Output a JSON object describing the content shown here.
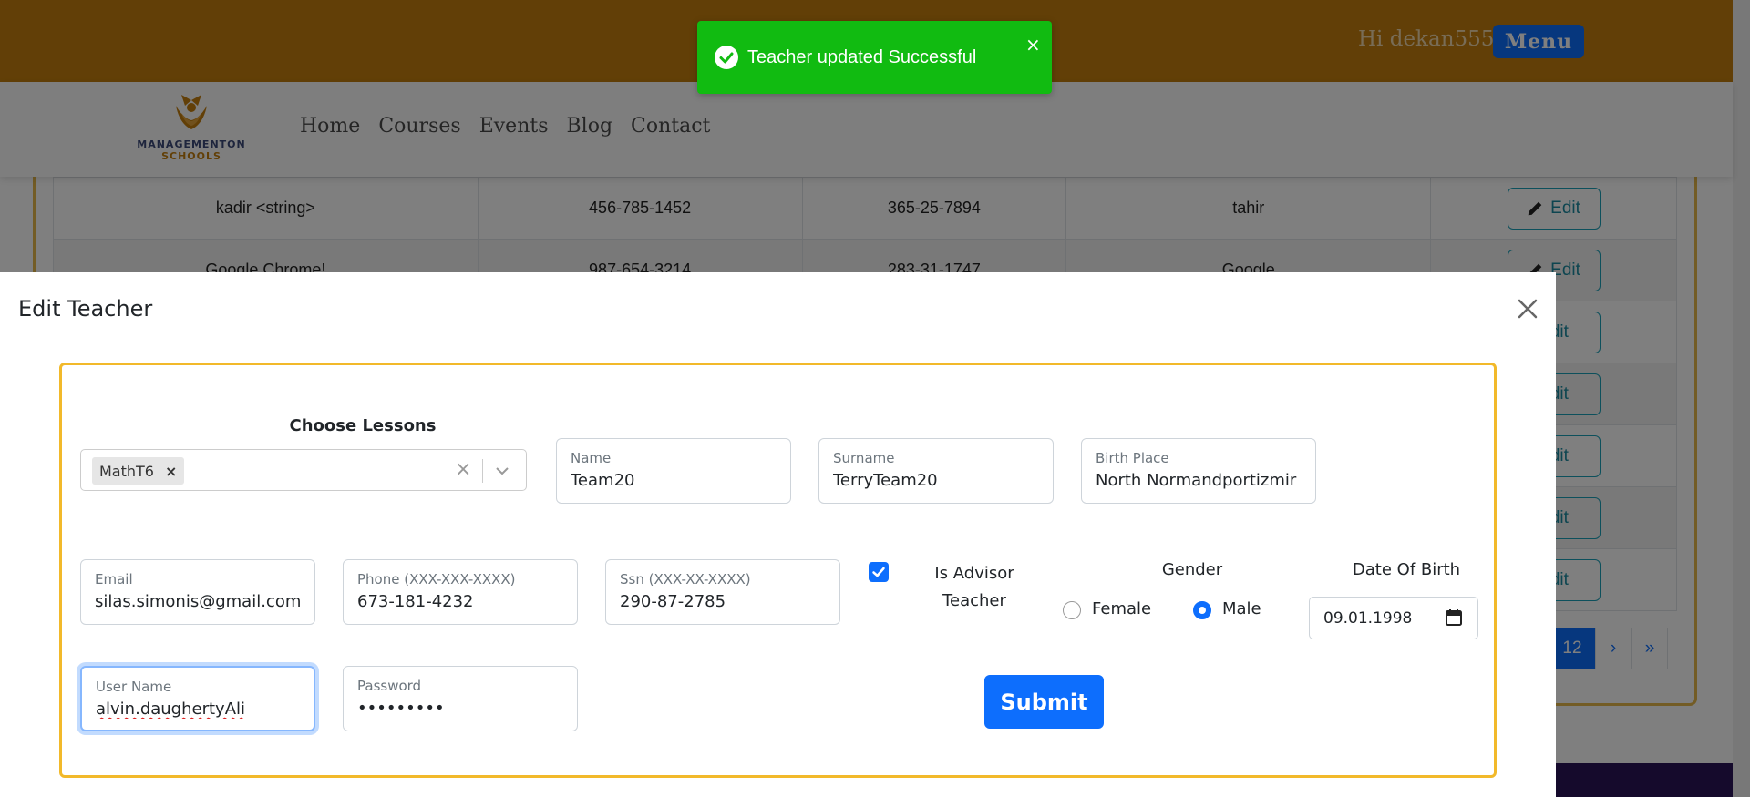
{
  "header": {
    "greeting": "Hi dekan555",
    "menu_label": "Menu",
    "colors": {
      "topbar": "#c47f0e",
      "accent": "#0d6efd"
    }
  },
  "logo": {
    "line1": "MANAGEMENTON",
    "line2": "SCHOOLS"
  },
  "nav": {
    "links": [
      "Home",
      "Courses",
      "Events",
      "Blog",
      "Contact"
    ]
  },
  "table": {
    "rows": [
      {
        "name": "kadir <string>",
        "phone": "456-785-1452",
        "ssn": "365-25-7894",
        "username": "tahir",
        "action": "Edit"
      },
      {
        "name": "Google Chrome!",
        "phone": "987-654-3214",
        "ssn": "283-31-1747",
        "username": "Google",
        "action": "Edit"
      }
    ],
    "edit_label": "Edit"
  },
  "pagination": {
    "current": "12",
    "next": "›",
    "last": "»"
  },
  "toast": {
    "message": "Teacher updated Successful",
    "close": "×",
    "icon": "check-circle-icon",
    "color": "#11bb11"
  },
  "modal": {
    "title": "Edit Teacher",
    "choose_lessons_label": "Choose Lessons",
    "selected_lessons": [
      "MathT6"
    ],
    "fields": {
      "name": {
        "label": "Name",
        "value": "Team20"
      },
      "surname": {
        "label": "Surname",
        "value": "TerryTeam20"
      },
      "birth_place": {
        "label": "Birth Place",
        "value": "North Normandportizmir"
      },
      "email": {
        "label": "Email",
        "value": "silas.simonis@gmail.com"
      },
      "phone": {
        "label": "Phone (XXX-XXX-XXXX)",
        "value": "673-181-4232"
      },
      "ssn": {
        "label": "Ssn (XXX-XX-XXXX)",
        "value": "290-87-2785"
      },
      "username": {
        "label": "User Name",
        "value": "alvin.daughertyAli"
      },
      "password": {
        "label": "Password",
        "value": "•••••••••"
      }
    },
    "advisor": {
      "line1": "Is Advisor",
      "line2": "Teacher",
      "checked": true
    },
    "gender": {
      "label": "Gender",
      "options": [
        "Female",
        "Male"
      ],
      "selected": "Male"
    },
    "dob": {
      "label": "Date Of Birth",
      "value": "09.01.1998"
    },
    "submit_label": "Submit"
  }
}
